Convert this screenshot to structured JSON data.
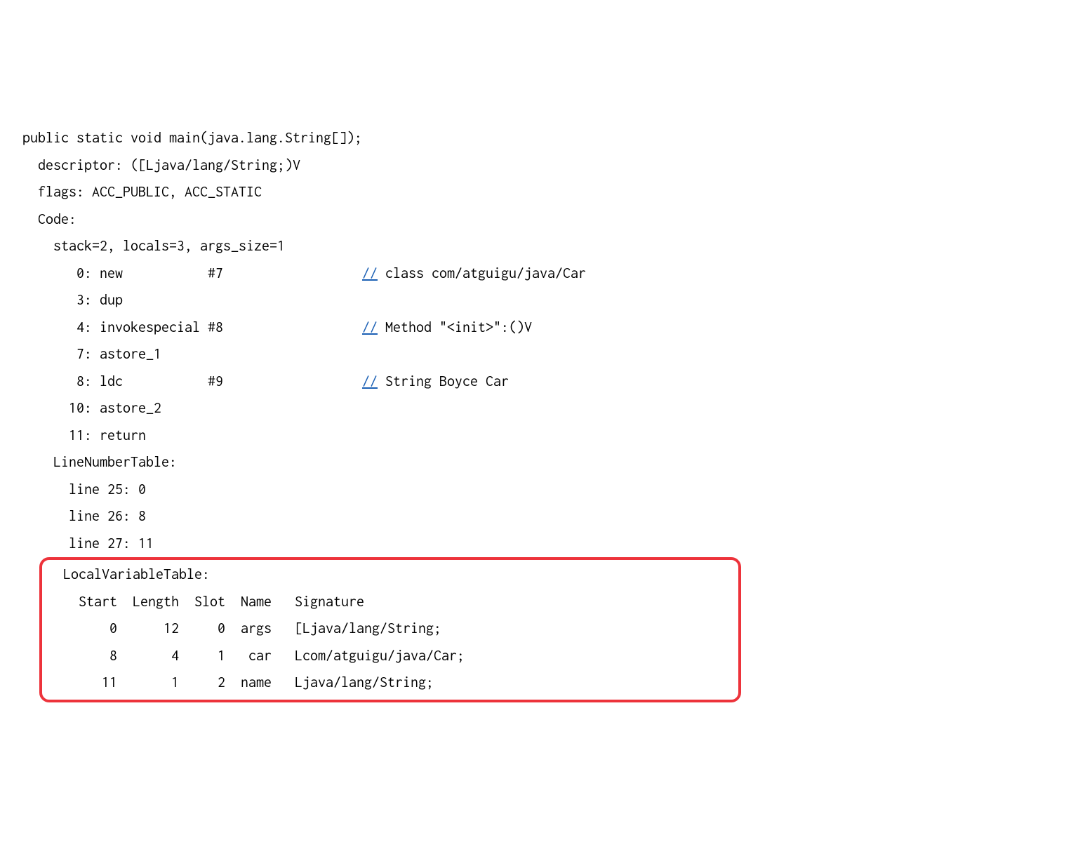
{
  "signature": "public static void main(java.lang.String[]);",
  "descriptor_line": "  descriptor: ([Ljava/lang/String;)V",
  "flags_line": "  flags: ACC_PUBLIC, ACC_STATIC",
  "code_label": "  Code:",
  "stack_line": "    stack=2, locals=3, args_size=1",
  "instr": {
    "i0_pre": "       0: new           #7                  ",
    "i0_slash": "//",
    "i0_comment": " class com/atguigu/java/Car",
    "i1": "       3: dup",
    "i2_pre": "       4: invokespecial #8                  ",
    "i2_slash": "//",
    "i2_comment": " Method \"<init>\":()V",
    "i3": "       7: astore_1",
    "i4_pre": "       8: ldc           #9                  ",
    "i4_slash": "//",
    "i4_comment": " String Boyce Car",
    "i5": "      10: astore_2",
    "i6": "      11: return"
  },
  "lnt_label": "    LineNumberTable:",
  "lnt": {
    "l0": "      line 25: 0",
    "l1": "      line 26: 8",
    "l2": "      line 27: 11"
  },
  "lvt_label": "  LocalVariableTable:",
  "lvt_header": "    Start  Length  Slot  Name   Signature",
  "lvt_rows": {
    "r0": "        0      12     0  args   [Ljava/lang/String;",
    "r1": "        8       4     1   car   Lcom/atguigu/java/Car;",
    "r2": "       11       1     2  name   Ljava/lang/String;"
  }
}
